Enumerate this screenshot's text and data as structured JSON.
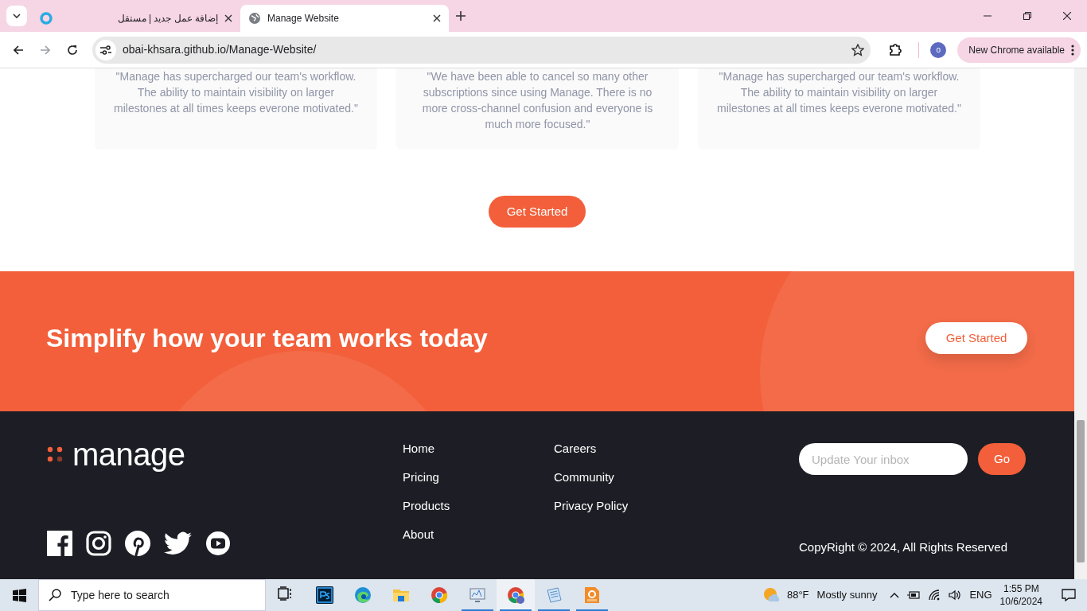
{
  "browser": {
    "tabs": [
      {
        "title": "إضافة عمل جديد | مستقل",
        "kind": "ring",
        "selected": false
      },
      {
        "title": "Manage Website",
        "kind": "globe",
        "selected": true
      }
    ],
    "url": "obai-khsara.github.io/Manage-Website/",
    "forward_disabled": true,
    "profile_initial": "o",
    "update_label": "New Chrome available"
  },
  "page": {
    "testimonials": [
      {
        "quote": "\"Manage has supercharged our team's workflow. The ability to maintain visibility on larger milestones at all times keeps everone motivated.\""
      },
      {
        "quote": "\"We have been able to cancel so many other subscriptions since using Manage. There is no more cross-channel confusion and everyone is much more focused.\""
      },
      {
        "quote": "\"Manage has supercharged our team's workflow. The ability to maintain visibility on larger milestones at all times keeps everone motivated.\""
      }
    ],
    "cta_button": "Get Started",
    "banner": {
      "heading": "Simplify how your team works today",
      "button": "Get Started"
    },
    "footer": {
      "logo": "manage",
      "links_1": [
        "Home",
        "Pricing",
        "Products",
        "About"
      ],
      "links_2": [
        "Careers",
        "Community",
        "Privacy Policy"
      ],
      "newsletter": {
        "placeholder": "Update Your inbox",
        "button": "Go"
      },
      "socials": [
        {
          "kind": "facebook"
        },
        {
          "kind": "instagram"
        },
        {
          "kind": "pinterest"
        },
        {
          "kind": "twitter"
        },
        {
          "kind": "youtube"
        }
      ],
      "copyright": "CopyRight © 2024, All Rights Reserved"
    }
  },
  "taskbar": {
    "search_placeholder": "Type here to search",
    "apps": [
      {
        "kind": "taskview",
        "running": false,
        "selected": false
      },
      {
        "kind": "tile",
        "running": false,
        "selected": false
      },
      {
        "kind": "swirl",
        "running": false,
        "selected": false
      },
      {
        "kind": "folder",
        "running": false,
        "selected": false
      },
      {
        "kind": "ring",
        "running": false,
        "selected": false
      },
      {
        "kind": "monitor",
        "running": true,
        "selected": false
      },
      {
        "kind": "ring_badge",
        "running": true,
        "selected": true
      },
      {
        "kind": "notepad",
        "running": true,
        "selected": false
      },
      {
        "kind": "document",
        "running": true,
        "selected": false
      }
    ],
    "weather": {
      "temp": "88°F",
      "text": "Mostly sunny"
    },
    "language": "ENG",
    "time": "1:55 PM",
    "date": "10/6/2024"
  }
}
